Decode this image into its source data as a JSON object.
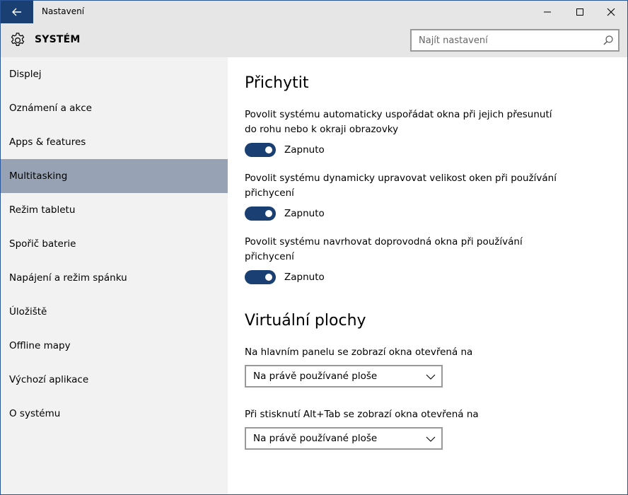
{
  "window": {
    "title": "Nastavení"
  },
  "header": {
    "title": "SYSTÉM",
    "search_placeholder": "Najít nastavení"
  },
  "sidebar": {
    "items": [
      {
        "label": "Displej"
      },
      {
        "label": "Oznámení a akce"
      },
      {
        "label": "Apps & features"
      },
      {
        "label": "Multitasking",
        "selected": true
      },
      {
        "label": "Režim tabletu"
      },
      {
        "label": "Spořič baterie"
      },
      {
        "label": "Napájení a režim spánku"
      },
      {
        "label": "Úložiště"
      },
      {
        "label": "Offline mapy"
      },
      {
        "label": "Výchozí aplikace"
      },
      {
        "label": "O systému"
      }
    ]
  },
  "main": {
    "snap": {
      "title": "Přichytit",
      "settings": [
        {
          "line1": "Povolit systému automaticky uspořádat okna při jejich přesunutí",
          "line2": "do rohu nebo k okraji obrazovky",
          "state": "Zapnuto",
          "on": true
        },
        {
          "line1": "Povolit systému dynamicky upravovat velikost oken při používání",
          "line2": "přichycení",
          "state": "Zapnuto",
          "on": true
        },
        {
          "line1": "Povolit systému navrhovat doprovodná okna při používání",
          "line2": "přichycení",
          "state": "Zapnuto",
          "on": true
        }
      ]
    },
    "virtual": {
      "title": "Virtuální plochy",
      "taskbar_label": "Na hlavním panelu se zobrazí okna otevřená na",
      "taskbar_value": "Na právě používané ploše",
      "alttab_label": "Při stisknutí Alt+Tab se zobrazí okna otevřená na",
      "alttab_value": "Na právě používané ploše"
    }
  },
  "colors": {
    "accent": "#1a3f72",
    "selected_nav": "#97a3b4",
    "sidebar_bg": "#f2f2f2",
    "header_bg": "#e6e6e6"
  },
  "icons": {
    "back": "arrow-left-icon",
    "minimize": "minimize-icon",
    "maximize": "maximize-icon",
    "close": "close-icon",
    "settings": "gear-icon",
    "search": "search-icon",
    "dropdown": "chevron-down-icon"
  }
}
